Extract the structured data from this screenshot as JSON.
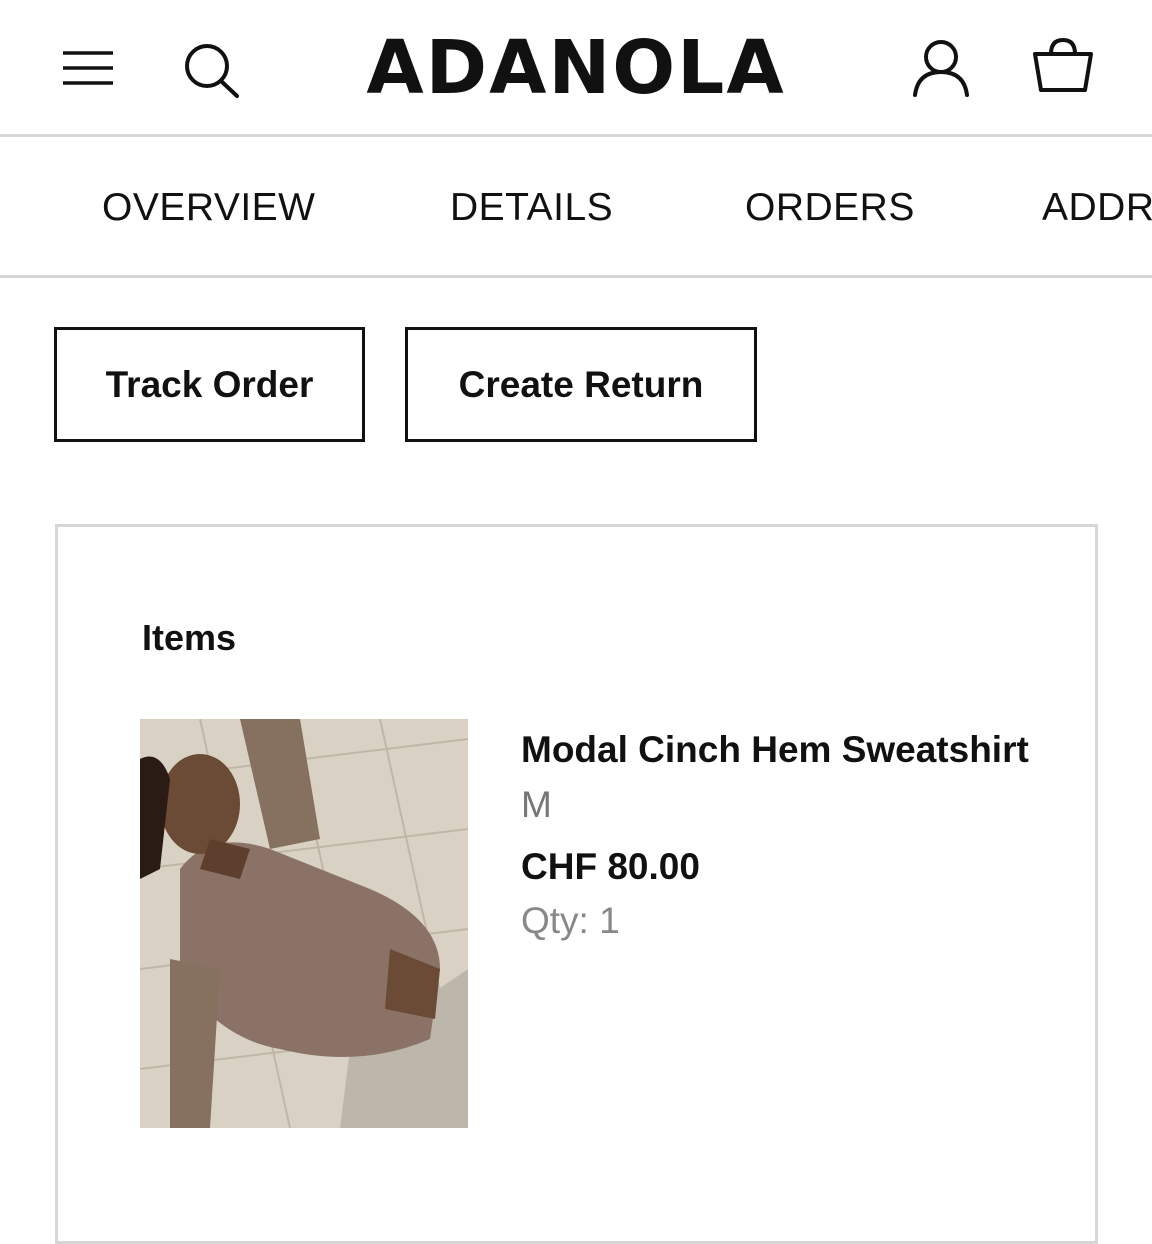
{
  "header": {
    "logo": "ADANOLA",
    "icons": {
      "menu": "menu-icon",
      "search": "search-icon",
      "account": "account-icon",
      "bag": "shopping-bag-icon"
    }
  },
  "tabs": [
    {
      "label": "OVERVIEW"
    },
    {
      "label": "DETAILS"
    },
    {
      "label": "ORDERS"
    },
    {
      "label": "ADDRESSES"
    }
  ],
  "actions": {
    "track_order": "Track Order",
    "create_return": "Create Return"
  },
  "items_section": {
    "heading": "Items",
    "items": [
      {
        "name": "Modal Cinch Hem Sweatshirt",
        "size": "M",
        "price": "CHF 80.00",
        "qty": "Qty: 1"
      }
    ]
  },
  "colors": {
    "text": "#111111",
    "muted": "#777777",
    "divider": "#d6d6d6"
  }
}
